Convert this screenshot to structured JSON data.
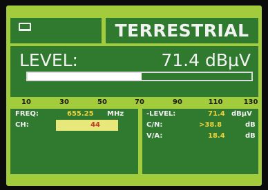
{
  "header": {
    "icon": "tv-icon",
    "title": "TERRESTRIAL"
  },
  "level": {
    "label": "LEVEL:",
    "value": "71.4 dBµV",
    "bar_fill_percent": 51
  },
  "scale": {
    "ticks": [
      "10",
      "30",
      "50",
      "70",
      "90",
      "110",
      "130"
    ]
  },
  "left_panel": {
    "freq_label": "FREQ:",
    "freq_value": "655.25",
    "freq_unit": "MHz",
    "ch_label": "CH:",
    "ch_value": "44"
  },
  "right_panel": {
    "level_label": "-LEVEL:",
    "level_value": "71.4",
    "level_unit": "dBµV",
    "cn_label": "C/N:",
    "cn_value": ">38.8",
    "cn_unit": "dB",
    "va_label": "V/A:",
    "va_value": "18.4",
    "va_unit": "dB"
  },
  "colors": {
    "background": "#a3cc3d",
    "panel": "#2f7a2f",
    "value_text": "#f2d23a",
    "channel_box": "#e8e87a"
  }
}
